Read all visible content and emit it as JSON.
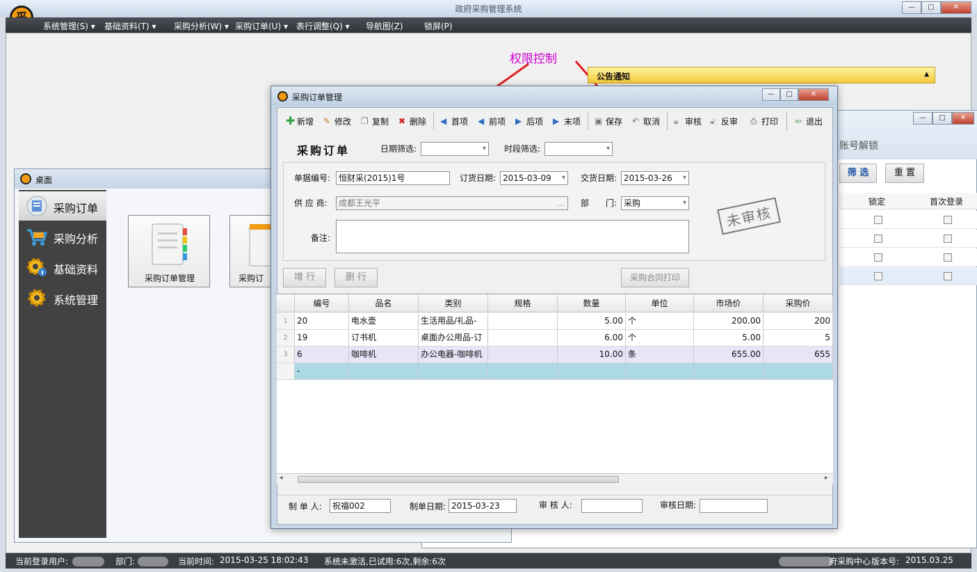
{
  "app": {
    "title": "政府采购管理系统",
    "logo_char": "采",
    "menu": [
      {
        "label": "系统管理(S)"
      },
      {
        "label": "基础资料(T)"
      },
      {
        "label": "采购分析(W)"
      },
      {
        "label": "采购订单(U)"
      },
      {
        "label": "表行调整(Q)"
      },
      {
        "label": "导航图(Z)"
      },
      {
        "label": "锁屏(P)"
      }
    ]
  },
  "annotation": {
    "text": "权限控制",
    "color": "#d100d1"
  },
  "notice": {
    "title": "公告通知"
  },
  "desktop": {
    "title": "桌面",
    "sidebar": [
      {
        "label": "采购订单",
        "icon": "purchase-order-icon"
      },
      {
        "label": "采购分析",
        "icon": "shopping-cart-icon"
      },
      {
        "label": "基础资料",
        "icon": "gear-info-icon"
      },
      {
        "label": "系统管理",
        "icon": "gear-icon"
      }
    ],
    "tiles": [
      {
        "label": "采购订单管理"
      },
      {
        "label": "采购订"
      }
    ]
  },
  "right_window": {
    "heading": "账号解锁",
    "filter_label": "筛 选",
    "reset_label": "重 置",
    "columns": [
      "锁定",
      "首次登录"
    ]
  },
  "dialog": {
    "title": "采购订单管理",
    "toolbar": {
      "new": "新增",
      "edit": "修改",
      "copy": "复制",
      "delete": "删除",
      "first": "首项",
      "prev": "前项",
      "next": "后项",
      "last": "末项",
      "save": "保存",
      "cancel": "取消",
      "audit": "审核",
      "unaudit": "反审",
      "print": "打印",
      "exit": "退出"
    },
    "heading": "采购订单",
    "date_filter_label": "日期筛选:",
    "period_filter_label": "时段筛选:",
    "form": {
      "doc_no_label": "单据编号:",
      "doc_no": "恒财采(2015)1号",
      "order_date_label": "订货日期:",
      "order_date": "2015-03-09",
      "delivery_date_label": "交货日期:",
      "delivery_date": "2015-03-26",
      "supplier_label": "供 应 商:",
      "supplier": "成都王光平",
      "dept_label_a": "部",
      "dept_label_b": "门:",
      "dept": "采购",
      "remark_label": "备注:"
    },
    "stamp": "未审核",
    "add_row": "增 行",
    "del_row": "删 行",
    "contract_print": "采购合同打印",
    "grid": {
      "columns": [
        "编号",
        "品名",
        "类别",
        "规格",
        "数量",
        "单位",
        "市场价",
        "采购价"
      ],
      "rows": [
        {
          "n": "1",
          "code": "20",
          "name": "电水壶",
          "cat": "生活用品/礼品-",
          "spec": "",
          "qty": "5.00",
          "unit": "个",
          "market": "200.00",
          "price": "200"
        },
        {
          "n": "2",
          "code": "19",
          "name": "订书机",
          "cat": "桌面办公用品-订",
          "spec": "",
          "qty": "6.00",
          "unit": "个",
          "market": "5.00",
          "price": "5"
        },
        {
          "n": "3",
          "code": "6",
          "name": "咖啡机",
          "cat": "办公电器-咖啡机",
          "spec": "",
          "qty": "10.00",
          "unit": "条",
          "market": "655.00",
          "price": "655"
        }
      ],
      "new_row_marker": "-"
    },
    "footer": {
      "creator_label": "制 单 人:",
      "creator": "祝福002",
      "create_date_label": "制单日期:",
      "create_date": "2015-03-23",
      "auditor_label": "审 核 人:",
      "auditor": "",
      "audit_date_label": "审核日期:",
      "audit_date": ""
    }
  },
  "status": {
    "user_label": "当前登录用户:",
    "dept_label": "部门:",
    "time_label": "当前时间:",
    "time": "2015-03-25 18:02:43",
    "activation": "系统未激活,已试用:6次,剩余:6次",
    "org": "府采购中心",
    "version_label": "版本号:",
    "version": "2015.03.25"
  }
}
